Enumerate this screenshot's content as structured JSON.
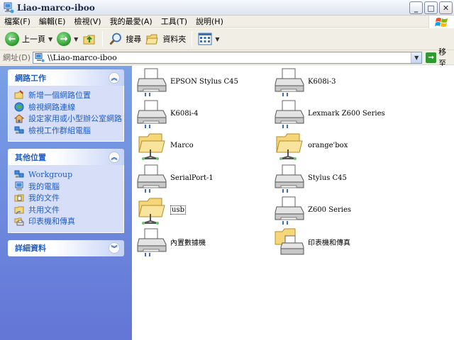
{
  "window": {
    "title": "Liao-marco-iboo"
  },
  "window_buttons": {
    "minimize": "_",
    "maximize": "□",
    "close": "✕"
  },
  "menu": [
    {
      "label": "檔案(F)"
    },
    {
      "label": "編輯(E)"
    },
    {
      "label": "檢視(V)"
    },
    {
      "label": "我的最愛(A)"
    },
    {
      "label": "工具(T)"
    },
    {
      "label": "說明(H)"
    }
  ],
  "toolbar": {
    "back_label": "上一頁",
    "search_label": "搜尋",
    "folders_label": "資料夾"
  },
  "address": {
    "label": "網址(D)",
    "value": "\\\\Liao-marco-iboo",
    "go_label": "移至"
  },
  "taskpane": {
    "network_tasks": {
      "title": "網路工作",
      "items": [
        {
          "label": "新增一個網路位置",
          "icon": "add-network-place-icon"
        },
        {
          "label": "檢視網路連線",
          "icon": "network-connections-icon"
        },
        {
          "label": "設定家用或小型辦公室網路",
          "icon": "home-network-icon"
        },
        {
          "label": "檢視工作群組電腦",
          "icon": "workgroup-icon"
        }
      ]
    },
    "other_places": {
      "title": "其他位置",
      "items": [
        {
          "label": "Workgroup",
          "icon": "workgroup-icon"
        },
        {
          "label": "我的電腦",
          "icon": "my-computer-icon"
        },
        {
          "label": "我的文件",
          "icon": "my-documents-icon"
        },
        {
          "label": "共用文件",
          "icon": "shared-documents-icon"
        },
        {
          "label": "印表機和傳真",
          "icon": "printers-icon"
        }
      ]
    },
    "details": {
      "title": "詳細資料"
    }
  },
  "files": [
    {
      "label": "EPSON Stylus C45",
      "type": "printer"
    },
    {
      "label": "K608i-3",
      "type": "printer"
    },
    {
      "label": "K608i-4",
      "type": "printer"
    },
    {
      "label": "Lexmark  Z600 Series",
      "type": "printer"
    },
    {
      "label": "Marco",
      "type": "shared-folder"
    },
    {
      "label": "orange'box",
      "type": "shared-folder"
    },
    {
      "label": "SerialPort-1",
      "type": "printer"
    },
    {
      "label": "Stylus C45",
      "type": "printer"
    },
    {
      "label": "usb",
      "type": "shared-folder"
    },
    {
      "label": "Z600 Series",
      "type": "printer"
    },
    {
      "label": "內置數據機",
      "type": "printer"
    },
    {
      "label": "印表機和傳真",
      "type": "printers-folder"
    }
  ]
}
